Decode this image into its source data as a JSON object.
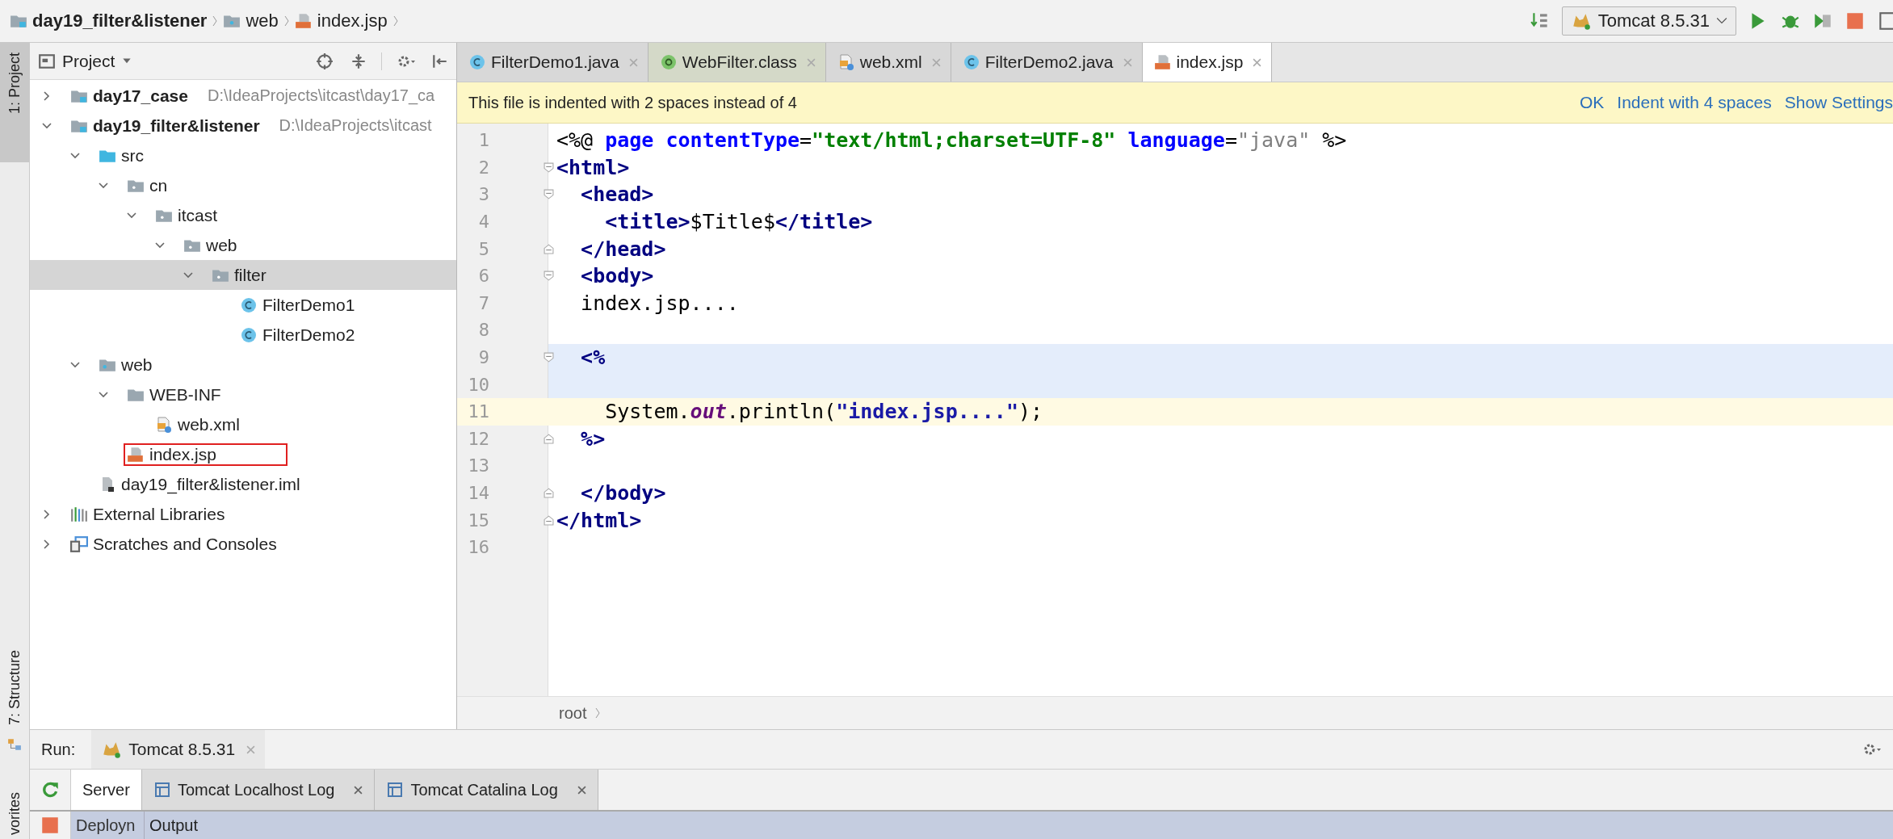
{
  "breadcrumb": [
    {
      "label": "day19_filter&listener",
      "kind": "module"
    },
    {
      "label": "web",
      "kind": "webroot"
    },
    {
      "label": "index.jsp",
      "kind": "jsp"
    }
  ],
  "toolbar": {
    "run_config": "Tomcat 8.5.31"
  },
  "side_strip": {
    "top": "1: Project",
    "middle": "7: Structure",
    "bottom": "vorites"
  },
  "project_panel": {
    "title": "Project",
    "tree": [
      {
        "label": "day17_case",
        "path": "D:\\IdeaProjects\\itcast\\day17_ca",
        "kind": "module",
        "expanded": false,
        "selected": false
      },
      {
        "label": "day19_filter&listener",
        "path": "D:\\IdeaProjects\\itcast",
        "kind": "module",
        "expanded": true,
        "selected": false,
        "children": [
          {
            "label": "src",
            "kind": "source",
            "expanded": true,
            "selected": false,
            "children": [
              {
                "label": "cn",
                "kind": "package",
                "expanded": true,
                "selected": false,
                "children": [
                  {
                    "label": "itcast",
                    "kind": "package",
                    "expanded": true,
                    "selected": false,
                    "children": [
                      {
                        "label": "web",
                        "kind": "package",
                        "expanded": true,
                        "selected": false,
                        "children": [
                          {
                            "label": "filter",
                            "kind": "package",
                            "expanded": true,
                            "selected": true,
                            "children": [
                              {
                                "label": "FilterDemo1",
                                "kind": "class",
                                "selected": false
                              },
                              {
                                "label": "FilterDemo2",
                                "kind": "class",
                                "selected": false
                              }
                            ]
                          }
                        ]
                      }
                    ]
                  }
                ]
              }
            ]
          },
          {
            "label": "web",
            "kind": "webroot",
            "expanded": true,
            "selected": false,
            "children": [
              {
                "label": "WEB-INF",
                "kind": "folder",
                "expanded": true,
                "selected": false,
                "children": [
                  {
                    "label": "web.xml",
                    "kind": "xml",
                    "selected": false
                  }
                ]
              },
              {
                "label": "index.jsp",
                "kind": "jsp",
                "selected": false,
                "outlined": true
              }
            ]
          },
          {
            "label": "day19_filter&listener.iml",
            "kind": "iml",
            "selected": false
          }
        ]
      },
      {
        "label": "External Libraries",
        "kind": "libraries",
        "expanded": false,
        "selected": false
      },
      {
        "label": "Scratches and Consoles",
        "kind": "scratches",
        "expanded": false,
        "selected": false
      }
    ]
  },
  "editor": {
    "tabs": [
      {
        "label": "FilterDemo1.java",
        "kind": "class",
        "selected": false
      },
      {
        "label": "WebFilter.class",
        "kind": "annotation",
        "selected": false
      },
      {
        "label": "web.xml",
        "kind": "xml",
        "selected": false
      },
      {
        "label": "FilterDemo2.java",
        "kind": "class",
        "selected": false
      },
      {
        "label": "index.jsp",
        "kind": "jsp",
        "selected": true
      }
    ],
    "notice": {
      "text": "This file is indented with 2 spaces instead of 4",
      "actions": [
        "OK",
        "Indent with 4 spaces",
        "Show Settings"
      ]
    },
    "lines": [
      {
        "number": "1",
        "current": false,
        "scriptlet": false,
        "segments": [
          {
            "text": "<%@",
            "kind": "plain"
          },
          {
            "text": " page",
            "kind": "attr"
          },
          {
            "text": " contentType",
            "kind": "attr"
          },
          {
            "text": "=",
            "kind": "plain"
          },
          {
            "text": "\"text/html;charset=UTF-8\"",
            "kind": "value"
          },
          {
            "text": " language",
            "kind": "attr"
          },
          {
            "text": "=",
            "kind": "plain"
          },
          {
            "text": "\"java\"",
            "kind": "dim"
          },
          {
            "text": " %>",
            "kind": "plain"
          }
        ]
      },
      {
        "number": "2",
        "current": false,
        "scriptlet": false,
        "fold": {
          "kind": "start"
        },
        "segments": [
          {
            "text": "<html>",
            "kind": "tag"
          }
        ]
      },
      {
        "number": "3",
        "current": false,
        "scriptlet": false,
        "fold": {
          "kind": "start"
        },
        "segments": [
          {
            "text": "  <head>",
            "kind": "tag"
          }
        ]
      },
      {
        "number": "4",
        "current": false,
        "scriptlet": false,
        "segments": [
          {
            "text": "    <title>",
            "kind": "tag"
          },
          {
            "text": "$Title$",
            "kind": "plain"
          },
          {
            "text": "</title>",
            "kind": "tag"
          }
        ]
      },
      {
        "number": "5",
        "current": false,
        "scriptlet": false,
        "fold": {
          "kind": "end"
        },
        "segments": [
          {
            "text": "  </head>",
            "kind": "tag"
          }
        ]
      },
      {
        "number": "6",
        "current": false,
        "scriptlet": false,
        "fold": {
          "kind": "start"
        },
        "segments": [
          {
            "text": "  <body>",
            "kind": "tag"
          }
        ]
      },
      {
        "number": "7",
        "current": false,
        "scriptlet": false,
        "segments": [
          {
            "text": "  index.jsp....",
            "kind": "plain"
          }
        ]
      },
      {
        "number": "8",
        "current": false,
        "scriptlet": false
      },
      {
        "number": "9",
        "current": false,
        "scriptlet": true,
        "fold": {
          "kind": "start"
        },
        "segments": [
          {
            "text": "  <%",
            "kind": "tag"
          }
        ]
      },
      {
        "number": "10",
        "current": false,
        "scriptlet": true
      },
      {
        "number": "11",
        "current": true,
        "scriptlet": false,
        "segments": [
          {
            "text": "    System.",
            "kind": "plain"
          },
          {
            "text": "out",
            "kind": "field"
          },
          {
            "text": ".println(",
            "kind": "plain"
          },
          {
            "text": "\"index.jsp....\"",
            "kind": "string"
          },
          {
            "text": ");",
            "kind": "plain"
          }
        ]
      },
      {
        "number": "12",
        "current": false,
        "scriptlet": false,
        "fold": {
          "kind": "end"
        },
        "segments": [
          {
            "text": "  %>",
            "kind": "tag"
          }
        ]
      },
      {
        "number": "13",
        "current": false,
        "scriptlet": false
      },
      {
        "number": "14",
        "current": false,
        "scriptlet": false,
        "fold": {
          "kind": "end"
        },
        "segments": [
          {
            "text": "  </body>",
            "kind": "tag"
          }
        ]
      },
      {
        "number": "15",
        "current": false,
        "scriptlet": false,
        "fold": {
          "kind": "end"
        },
        "segments": [
          {
            "text": "</html>",
            "kind": "tag"
          }
        ]
      },
      {
        "number": "16",
        "current": false,
        "scriptlet": false
      }
    ],
    "breadcrumb": "root"
  },
  "run_panel": {
    "label": "Run:",
    "tab": "Tomcat 8.5.31",
    "subtabs": [
      {
        "label": "Server",
        "selected": true,
        "closable": false
      },
      {
        "label": "Tomcat Localhost Log",
        "selected": false,
        "closable": true
      },
      {
        "label": "Tomcat Catalina Log",
        "selected": false,
        "closable": true
      }
    ],
    "columns": [
      "Deployn",
      "Output"
    ]
  }
}
